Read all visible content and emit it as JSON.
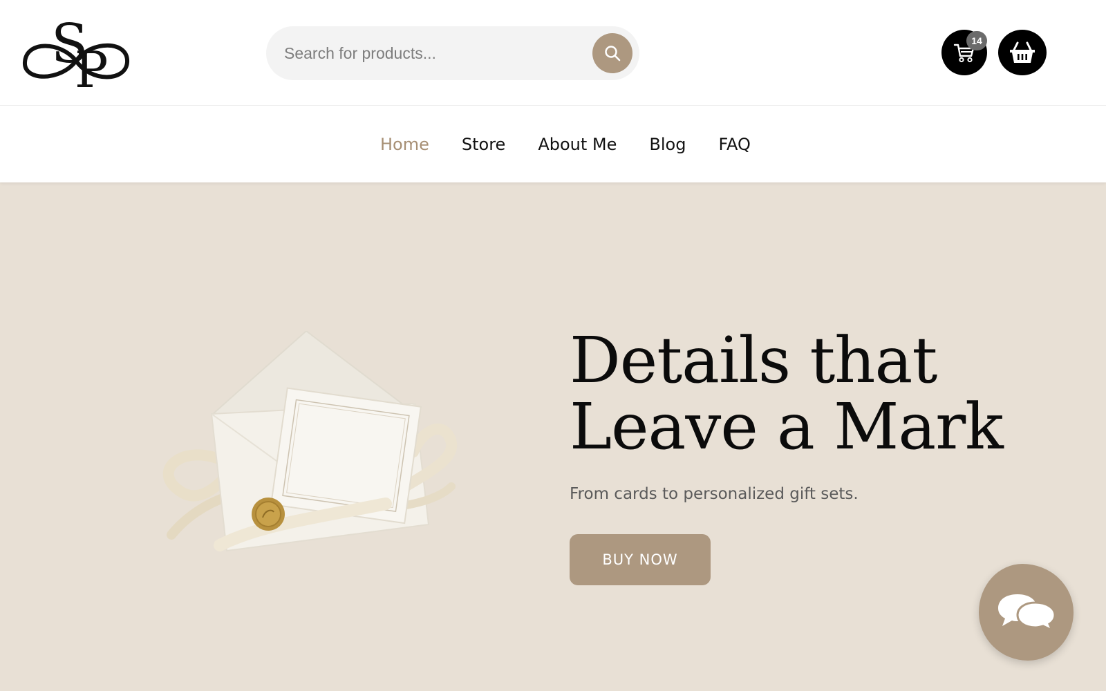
{
  "header": {
    "search": {
      "placeholder": "Search for products...",
      "value": ""
    },
    "cart": {
      "badge_count": "14",
      "icon": "cart-icon"
    },
    "basket": {
      "icon": "basket-icon"
    },
    "logo": {
      "text": "SP"
    }
  },
  "nav": {
    "items": [
      {
        "label": "Home",
        "active": true
      },
      {
        "label": "Store",
        "active": false
      },
      {
        "label": "About Me",
        "active": false
      },
      {
        "label": "Blog",
        "active": false
      },
      {
        "label": "FAQ",
        "active": false
      }
    ]
  },
  "hero": {
    "headline_line1": "Details that",
    "headline_line2": "Leave a Mark",
    "subtitle": "From cards to personalized gift sets.",
    "cta_label": "BUY NOW"
  },
  "chat": {
    "icon": "chat-bubbles-icon"
  },
  "colors": {
    "accent": "#ad9880",
    "nav_active": "#a78f74",
    "hero_background": "#e8e0d5",
    "badge": "#6b6b6b"
  }
}
